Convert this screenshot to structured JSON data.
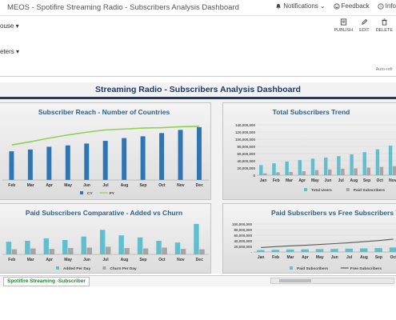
{
  "topbar": {
    "title": "MEOS - Spotifire Streaming Radio - Subscribers Analysis Dashboard",
    "notifications": "Notifications",
    "feedback": "Feedback",
    "info": "Info"
  },
  "filters": {
    "selector_text": "ouse",
    "params_text": "eters"
  },
  "actions": {
    "publish": "PUBLISH",
    "edit": "EDIT",
    "delete": "DELETE"
  },
  "auto_refresh": "Auto-refr",
  "dashboard": {
    "title": "Streaming Radio - Subscribers Analysis Dashboard"
  },
  "tabs": {
    "sheet": "Spotifire Streaming -Subscriber"
  },
  "colors": {
    "bar_dark": "#2e75b6",
    "bar_teal": "#5fbfcf",
    "bar_grey": "#a5a5a5",
    "line_green": "#92d050",
    "line_dark": "#595959",
    "title_blue": "#2e5f8a"
  },
  "chart_data": [
    {
      "id": "reach",
      "type": "bar",
      "title": "Subscriber Reach - Number of Countries",
      "categories": [
        "Feb",
        "Mar",
        "Apr",
        "May",
        "Jun",
        "Jul",
        "Aug",
        "Sep",
        "Oct",
        "Nov",
        "Dec"
      ],
      "series": [
        {
          "name": "CY",
          "kind": "bar",
          "values": [
            63,
            67,
            73,
            76,
            80,
            86,
            92,
            96,
            103,
            110,
            116
          ]
        },
        {
          "name": "PY",
          "kind": "line",
          "values": [
            77,
            84,
            92,
            99,
            105,
            110,
            112,
            114,
            115,
            117,
            118
          ]
        }
      ],
      "ylim": [
        0,
        130
      ],
      "legend": "bottom"
    },
    {
      "id": "total",
      "type": "bar",
      "title": "Total Subscribers Trend",
      "categories": [
        "Jan",
        "Feb",
        "Mar",
        "Apr",
        "May",
        "Jun",
        "Jul",
        "Aug",
        "Sep",
        "Oct",
        "Nov"
      ],
      "yticks": [
        "0",
        "20,000,000",
        "40,000,000",
        "60,000,000",
        "80,000,000",
        "100,000,000",
        "120,000,000",
        "140,000,000"
      ],
      "series": [
        {
          "name": "Total Users",
          "values": [
            28000000,
            33000000,
            38000000,
            42000000,
            46000000,
            49000000,
            53000000,
            58000000,
            64000000,
            72000000,
            82000000
          ]
        },
        {
          "name": "Paid Subscribers",
          "values": [
            5000000,
            8000000,
            9000000,
            11000000,
            14000000,
            16000000,
            18000000,
            19000000,
            21000000,
            23000000,
            25000000
          ]
        }
      ],
      "ylim": [
        0,
        140000000
      ],
      "legend": "bottom"
    },
    {
      "id": "comparative",
      "type": "bar",
      "title": "Paid Subscribers Comparative - Added vs Churn",
      "categories": [
        "Feb",
        "Mar",
        "Apr",
        "May",
        "Jun",
        "Jul",
        "Aug",
        "Sep",
        "Oct",
        "Nov",
        "Dec"
      ],
      "series": [
        {
          "name": "Added Per Day",
          "values": [
            30,
            32,
            38,
            34,
            42,
            58,
            45,
            40,
            32,
            28,
            72
          ]
        },
        {
          "name": "Churn Per Day",
          "values": [
            12,
            14,
            13,
            15,
            16,
            18,
            15,
            14,
            16,
            13,
            12
          ]
        }
      ],
      "ylim": [
        0,
        85
      ],
      "legend": "bottom"
    },
    {
      "id": "paidfree",
      "type": "bar",
      "title": "Paid Subscribers vs Free Subscribers Tr",
      "categories": [
        "Jan",
        "Feb",
        "Mar",
        "Apr",
        "May",
        "Jun",
        "Jul",
        "Aug",
        "Sep",
        "Oct"
      ],
      "yticks": [
        "-",
        "20,000,000",
        "40,000,000",
        "60,000,000",
        "80,000,000",
        "100,000,000"
      ],
      "series": [
        {
          "name": "Paid Subscribers",
          "kind": "bar",
          "values": [
            7000000,
            8000000,
            9000000,
            9500000,
            10500000,
            11000000,
            12000000,
            13000000,
            14000000,
            16000000
          ]
        },
        {
          "name": "Free Subscribers",
          "kind": "line",
          "values": [
            16000000,
            19000000,
            22000000,
            24000000,
            27000000,
            30000000,
            33000000,
            37000000,
            41000000,
            46000000
          ]
        }
      ],
      "ylim": [
        0,
        100000000
      ],
      "legend": "bottom"
    }
  ]
}
